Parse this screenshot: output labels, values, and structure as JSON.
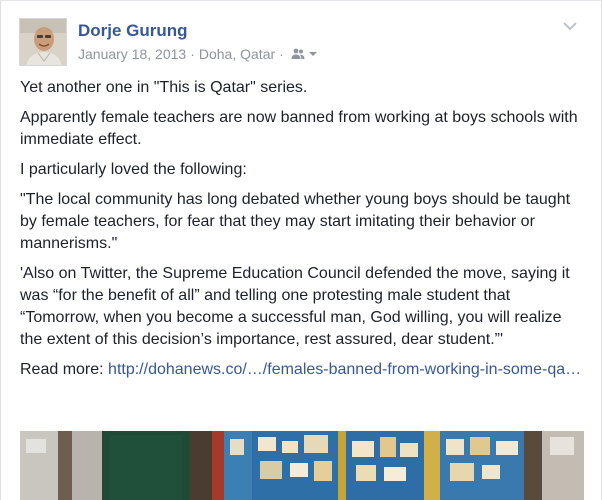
{
  "post": {
    "author": "Dorje Gurung",
    "date": "January 18, 2013",
    "location": "Doha, Qatar",
    "audience_icon": "friends-icon",
    "paragraphs": [
      "Yet another one in \"This is Qatar\" series.",
      "Apparently female teachers are now banned from working at boys schools with immediate effect.",
      "I particularly loved the following:",
      "\"The local community has long debated whether young boys should be taught by female teachers, for fear that they may start imitating their behavior or mannerisms.\"",
      "'Also on Twitter, the Supreme Education Council defended the move, saying it was “for the benefit of all” and telling one protesting male student that “Tomorrow, when you become a successful man, God willing, you will realize the extent of this decision’s importance, rest assured, dear student.”'"
    ],
    "read_more_label": "Read more:",
    "read_more_link": "http://dohanews.co/…/females-banned-from-working-in-some-qa…"
  },
  "colors": {
    "link": "#365899",
    "meta": "#90949c",
    "text": "#1d2129"
  }
}
